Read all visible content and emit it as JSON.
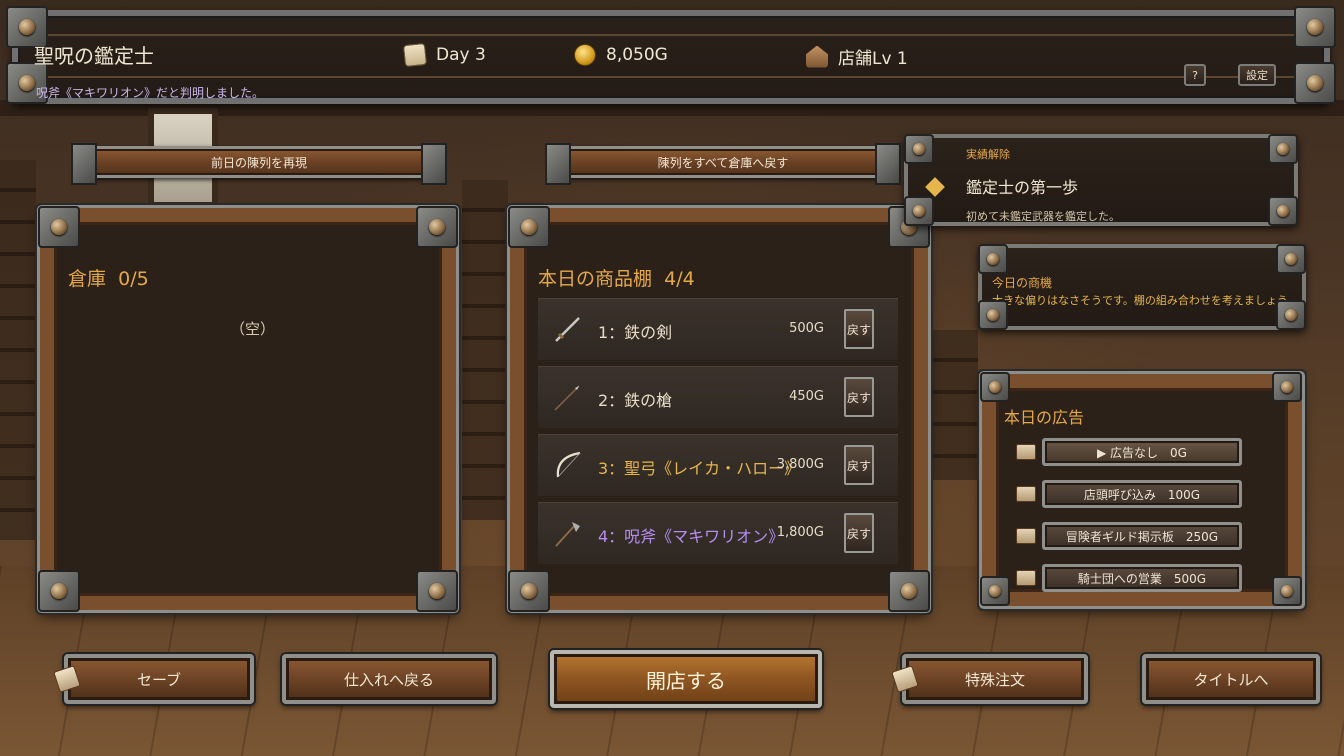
{
  "header": {
    "title": "聖呪の鑑定士",
    "day": "Day 3",
    "gold": "8,050G",
    "shop_level": "店舗Lv 1",
    "log_message": "呪斧《マキワリオン》だと判明しました。",
    "help_label": "?",
    "settings_label": "設定"
  },
  "toolbar": {
    "restore_label": "前日の陳列を再現",
    "return_all_label": "陳列をすべて倉庫へ戻す"
  },
  "warehouse": {
    "title": "倉庫",
    "count": "0/5",
    "empty_text": "（空）"
  },
  "shelf": {
    "title": "本日の商品棚",
    "count": "4/4",
    "return_label": "戻す",
    "items": [
      {
        "name": "1：鉄の剣",
        "price": "500G",
        "rarity": "normal",
        "icon": "sword-icon"
      },
      {
        "name": "2：鉄の槍",
        "price": "450G",
        "rarity": "normal",
        "icon": "spear-icon"
      },
      {
        "name": "3：聖弓《レイカ・ハロー》",
        "price": "3,800G",
        "rarity": "holy",
        "icon": "bow-icon"
      },
      {
        "name": "4：呪斧《マキワリオン》",
        "price": "1,800G",
        "rarity": "cursed",
        "icon": "axe-icon"
      }
    ]
  },
  "achievement": {
    "label": "実績解除",
    "name": "鑑定士の第一歩",
    "description": "初めて未鑑定武器を鑑定した。"
  },
  "opportunity": {
    "label": "今日の商機",
    "text": "大きな偏りはなさそうです。棚の組み合わせを考えましょう。"
  },
  "ads": {
    "title": "本日の広告",
    "options": [
      {
        "label": "▶ 広告なし　0G",
        "selected": true
      },
      {
        "label": "店頭呼び込み　100G",
        "selected": false
      },
      {
        "label": "冒険者ギルド掲示板　250G",
        "selected": false
      },
      {
        "label": "騎士団への営業　500G",
        "selected": false
      }
    ]
  },
  "bottom": {
    "save": "セーブ",
    "restock": "仕入れへ戻る",
    "open_shop": "開店する",
    "special_order": "特殊注文",
    "to_title": "タイトルへ"
  },
  "colors": {
    "accent": "#e6a94a",
    "holy": "#e6b64d",
    "cursed": "#b58cf0"
  }
}
